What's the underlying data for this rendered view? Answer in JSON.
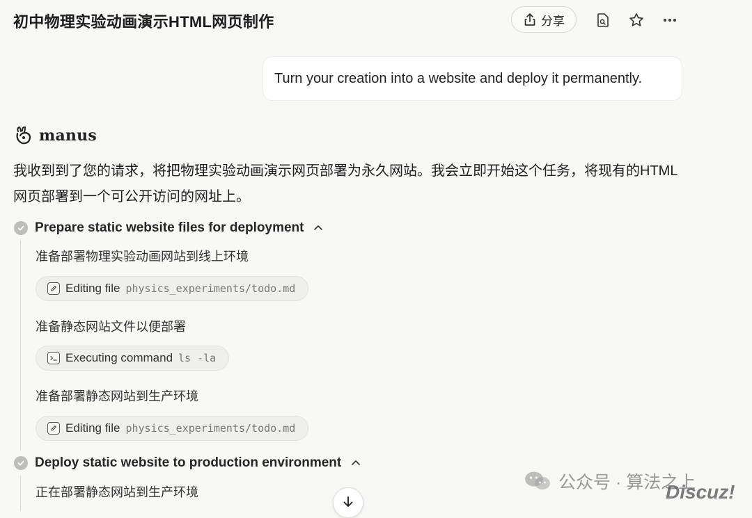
{
  "header": {
    "title": "初中物理实验动画演示HTML网页制作",
    "share_label": "分享"
  },
  "user_message": "Turn your creation into a website and deploy it permanently.",
  "assistant": {
    "name": "manus",
    "reply": "我收到到了您的请求，将把物理实验动画演示网页部署为永久网站。我会立即开始这个任务，将现有的HTML网页部署到一个可公开访问的网址上。"
  },
  "steps": [
    {
      "title": "Prepare static website files for deployment",
      "items": [
        {
          "text": "准备部署物理实验动画网站到线上环境",
          "action": "Editing file",
          "arg": "physics_experiments/todo.md",
          "icon": "edit-file-icon"
        },
        {
          "text": "准备静态网站文件以便部署",
          "action": "Executing command",
          "arg": "ls -la",
          "icon": "terminal-icon"
        },
        {
          "text": "准备部署静态网站到生产环境",
          "action": "Editing file",
          "arg": "physics_experiments/todo.md",
          "icon": "edit-file-icon"
        }
      ]
    },
    {
      "title": "Deploy static website to production environment",
      "items": [
        {
          "text": "正在部署静态网站到生产环境"
        }
      ]
    }
  ],
  "watermark": {
    "wechat": "公众号 · 算法之上",
    "site": "Discuz!"
  },
  "colors": {
    "background": "#f8f8f7",
    "chip_bg": "#efefed",
    "check": "#bdbdbb"
  }
}
